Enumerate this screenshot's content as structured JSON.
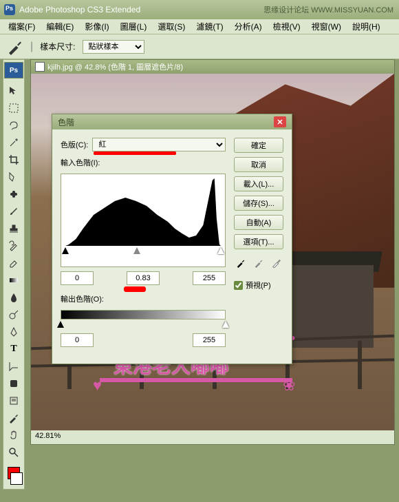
{
  "app": {
    "title": "Adobe Photoshop CS3 Extended",
    "watermark": "思缘设计论坛  WWW.MISSYUAN.COM"
  },
  "menu": {
    "file": "檔案(F)",
    "edit": "編輯(E)",
    "image": "影像(I)",
    "layer": "圖層(L)",
    "select": "選取(S)",
    "filter": "濾鏡(T)",
    "analysis": "分析(A)",
    "view": "檢視(V)",
    "window": "視窗(W)",
    "help": "說明(H)"
  },
  "options": {
    "sample_label": "樣本尺寸:",
    "sample_value": "點狀樣本"
  },
  "document": {
    "title": "kjilh.jpg @ 42.8% (色階 1, 圖層遮色片/8)",
    "zoom": "42.81%"
  },
  "dialog": {
    "title": "色階",
    "channel_label": "色版(C):",
    "channel_value": "紅",
    "input_label": "輸入色階(I):",
    "output_label": "輸出色階(O):",
    "in_black": "0",
    "in_gamma": "0.83",
    "in_white": "255",
    "out_black": "0",
    "out_white": "255",
    "ok": "確定",
    "cancel": "取消",
    "load": "載入(L)...",
    "save": "儲存(S)...",
    "auto": "自動(A)",
    "options": "選項(T)...",
    "preview": "預視(P)"
  }
}
